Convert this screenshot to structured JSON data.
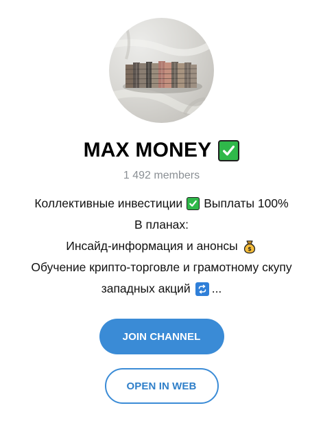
{
  "channel": {
    "title": "MAX MONEY",
    "title_emoji": "check-mark-button",
    "members": "1 492 members"
  },
  "description": {
    "line1_a": "Коллективные инвестиции",
    "line1_b": "Выплаты 100%",
    "line2": "В планах:",
    "line3": "Инсайд-информация и анонсы",
    "line4": "Обучение крипто-торговле и грамотному скупу",
    "line5_a": "западных акций",
    "line5_b": "..."
  },
  "buttons": {
    "join": "JOIN CHANNEL",
    "open_web": "OPEN IN WEB"
  },
  "colors": {
    "accent": "#3a8bd6",
    "check_green": "#2fb84a",
    "members_gray": "#8a8f94"
  },
  "icons": {
    "avatar": "money-stacks-photo",
    "title_check": "check-mark-button-icon",
    "inline_check": "check-mark-button-icon",
    "bag": "money-bag-icon",
    "repeat": "repeat-button-icon"
  }
}
